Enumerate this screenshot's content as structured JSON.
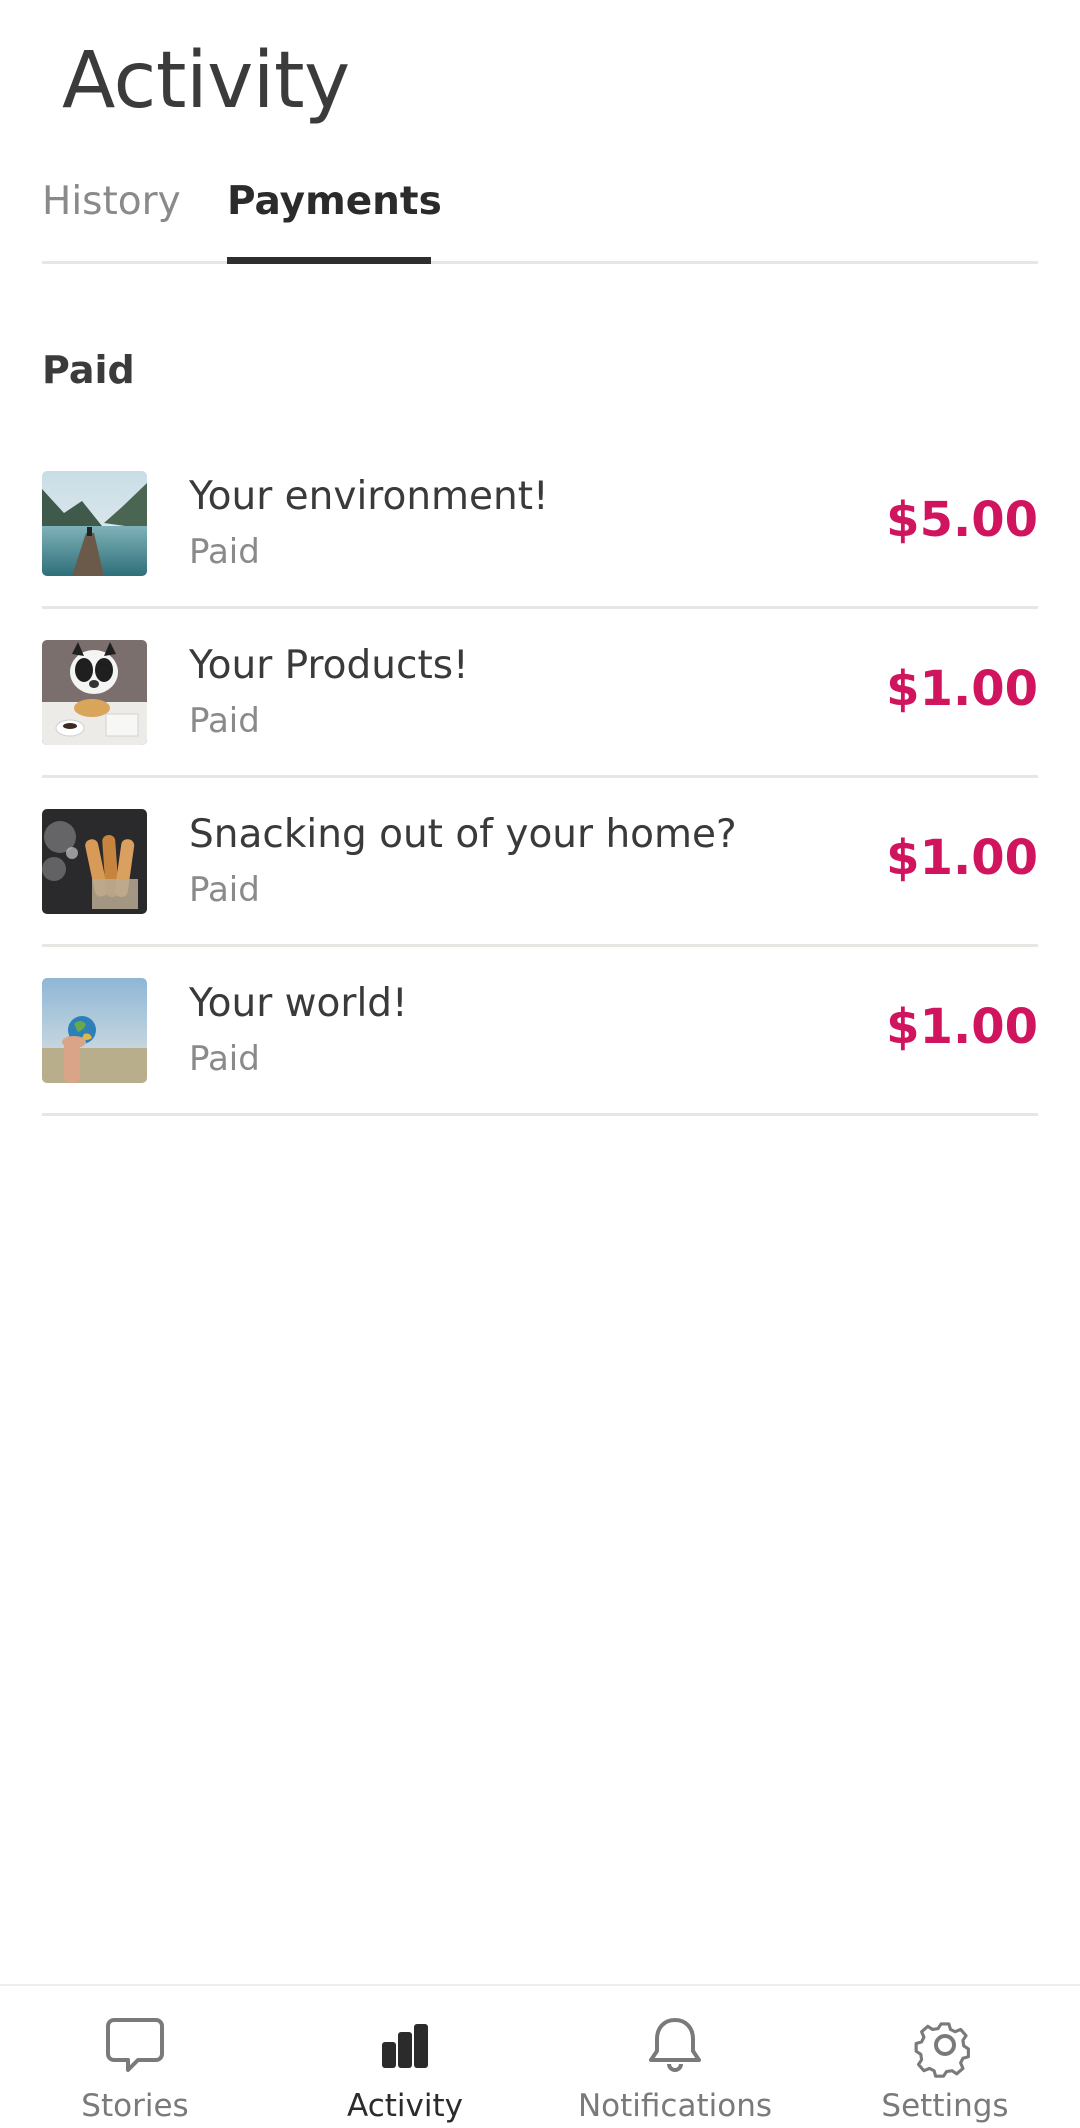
{
  "header": {
    "title": "Activity"
  },
  "tabs": [
    {
      "label": "History",
      "active": false
    },
    {
      "label": "Payments",
      "active": true
    }
  ],
  "section": {
    "heading": "Paid"
  },
  "payments": [
    {
      "title": "Your environment!",
      "status": "Paid",
      "amount": "$5.00",
      "thumbnail": "lake-dock-photo"
    },
    {
      "title": "Your Products!",
      "status": "Paid",
      "amount": "$1.00",
      "thumbnail": "dog-breakfast-photo"
    },
    {
      "title": "Snacking out of your home?",
      "status": "Paid",
      "amount": "$1.00",
      "thumbnail": "bread-flour-photo"
    },
    {
      "title": "Your world!",
      "status": "Paid",
      "amount": "$1.00",
      "thumbnail": "globe-in-hand-photo"
    }
  ],
  "bottom_nav": [
    {
      "label": "Stories",
      "icon": "chat-bubble-icon",
      "active": false
    },
    {
      "label": "Activity",
      "icon": "bar-chart-icon",
      "active": true
    },
    {
      "label": "Notifications",
      "icon": "bell-icon",
      "active": false
    },
    {
      "label": "Settings",
      "icon": "gear-icon",
      "active": false
    }
  ],
  "colors": {
    "accent": "#d0145e",
    "text_primary": "#3a3a3a",
    "text_secondary": "#8a8a8a",
    "divider": "#e8e6e3"
  }
}
